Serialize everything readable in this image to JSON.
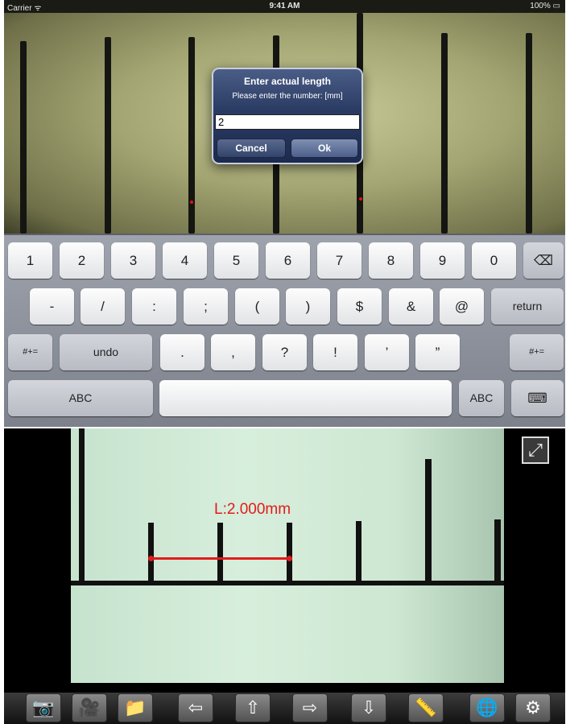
{
  "status_bar": {
    "carrier": "Carrier ᯤ",
    "time": "9:41 AM",
    "battery": "100% ▭"
  },
  "dialog": {
    "title": "Enter actual length",
    "message": "Please enter the number: [mm]",
    "input_value": "2",
    "cancel_label": "Cancel",
    "ok_label": "Ok"
  },
  "keyboard": {
    "row1": [
      "1",
      "2",
      "3",
      "4",
      "5",
      "6",
      "7",
      "8",
      "9",
      "0"
    ],
    "backspace_icon": "⌫",
    "row2": [
      "-",
      "/",
      ":",
      ";",
      "(",
      ")",
      "$",
      "&",
      "@"
    ],
    "return_label": "return",
    "row3_left": "#+=",
    "undo_label": "undo",
    "row3": [
      ".",
      ",",
      "?",
      "!",
      "’",
      "”"
    ],
    "row3_right": "#+=",
    "abc_left": "ABC",
    "abc_right": "ABC",
    "hide_keyboard_icon": "⌨"
  },
  "measurement": {
    "label": "L:2.000mm"
  },
  "expand_icon": "⤢",
  "toolbar": {
    "icons": [
      "camera-icon",
      "video-camera-icon",
      "folder-icon",
      "arrow-left-icon",
      "arrow-up-icon",
      "arrow-right-icon",
      "arrow-down-icon",
      "ruler-icon",
      "globe-icon",
      "gear-icon"
    ],
    "glyphs": [
      "📷",
      "🎥",
      "📁",
      "⇦",
      "⇧",
      "⇨",
      "⇩",
      "📏",
      "🌐",
      "⚙"
    ]
  }
}
